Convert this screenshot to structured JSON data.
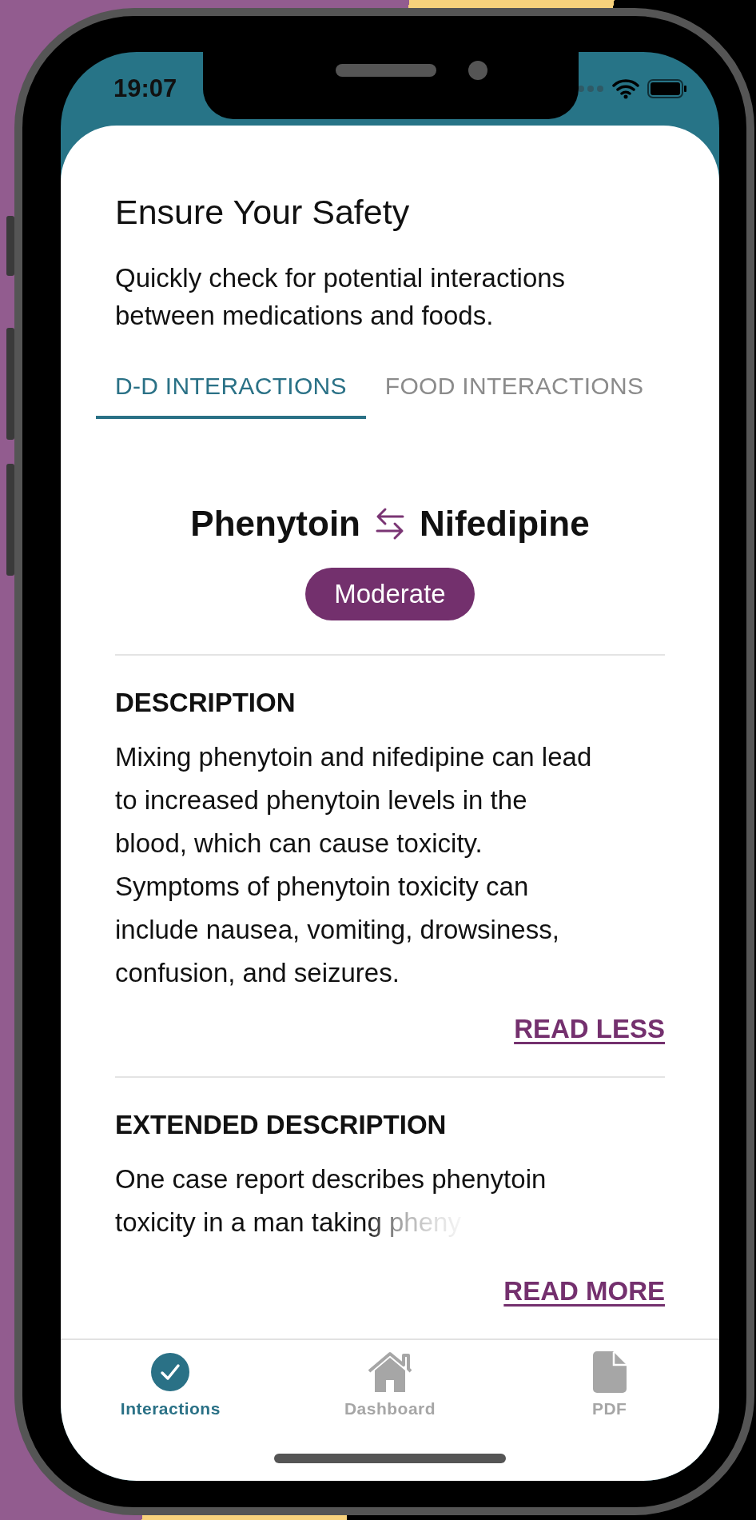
{
  "status_bar": {
    "time": "19:07"
  },
  "header": {
    "title": "Ensure Your Safety",
    "subtitle": "Quickly check for potential interactions between medications and foods."
  },
  "tabs": [
    {
      "label": "D-D INTERACTIONS",
      "selected": true
    },
    {
      "label": "FOOD INTERACTIONS",
      "selected": false
    }
  ],
  "interaction": {
    "drug_a": "Phenytoin",
    "drug_b": "Nifedipine",
    "severity": "Moderate"
  },
  "sections": [
    {
      "heading": "DESCRIPTION",
      "text": "Mixing phenytoin and nifedipine can lead to increased phenytoin levels in the blood, which can cause toxicity. Symptoms of phenytoin toxicity can include nausea, vomiting, drowsiness, confusion, and seizures.",
      "link": "READ LESS",
      "expanded": true
    },
    {
      "heading": "EXTENDED DESCRIPTION",
      "text": "One case report describes phenytoin toxicity in a man taking pheny",
      "link": "READ MORE",
      "expanded": false
    }
  ],
  "nav": [
    {
      "label": "Interactions",
      "kind": "check",
      "selected": true
    },
    {
      "label": "Dashboard",
      "kind": "home",
      "selected": false
    },
    {
      "label": "PDF",
      "kind": "document",
      "selected": false
    }
  ]
}
